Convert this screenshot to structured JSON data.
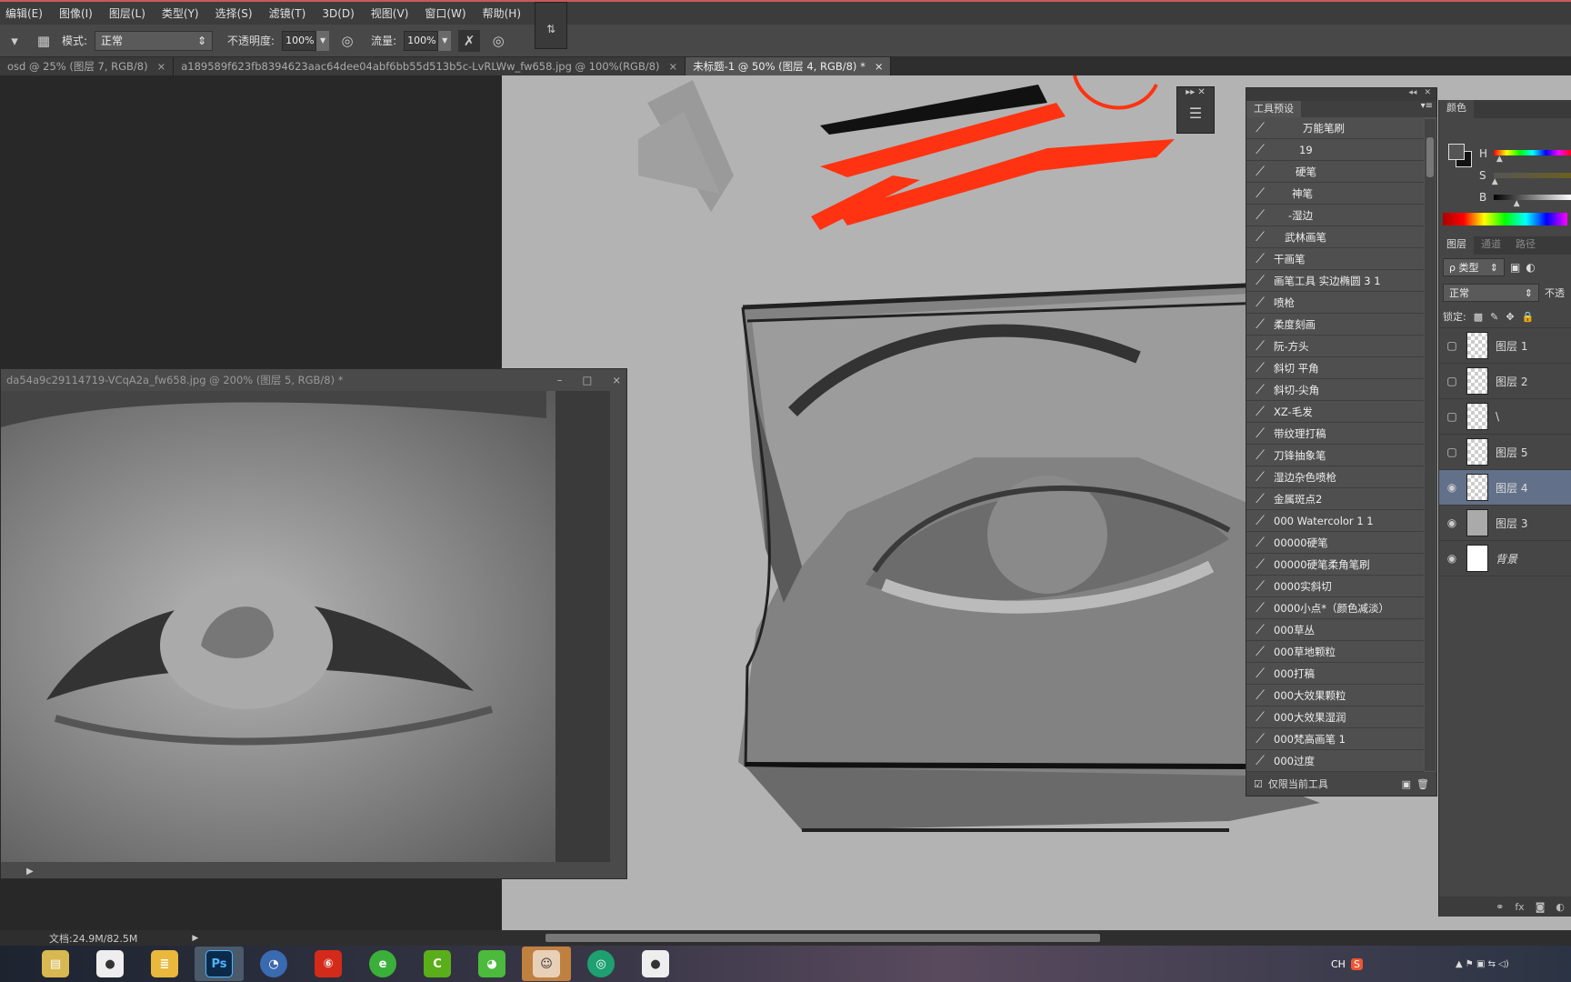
{
  "menu": [
    "编辑(E)",
    "图像(I)",
    "图层(L)",
    "类型(Y)",
    "选择(S)",
    "滤镜(T)",
    "3D(D)",
    "视图(V)",
    "窗口(W)",
    "帮助(H)"
  ],
  "options": {
    "mode_label": "模式:",
    "mode_value": "正常",
    "opacity_label": "不透明度:",
    "opacity_value": "100%",
    "flow_label": "流量:",
    "flow_value": "100%"
  },
  "tabs": [
    {
      "label": "osd @ 25% (图层 7, RGB/8)",
      "active": false
    },
    {
      "label": "a189589f623fb8394623aac64dee04abf6bb55d513b5c-LvRLWw_fw658.jpg @ 100%(RGB/8)",
      "active": false
    },
    {
      "label": "未标题-1 @ 50% (图层 4, RGB/8) *",
      "active": true
    }
  ],
  "tab_close": "×",
  "float_window": {
    "title": "da54a9c29114719-VCqA2a_fw658.jpg @ 200% (图层 5, RGB/8) *",
    "min": "–",
    "max": "□",
    "close": "×"
  },
  "presets": {
    "title": "工具预设",
    "items": [
      "万能笔刷",
      "19",
      "硬笔",
      "神笔",
      "-湿边",
      "武林画笔",
      "干画笔",
      "画笔工具 实边椭圆 3 1",
      "喷枪",
      "柔度刻画",
      "阮-方头",
      "斜切 平角",
      "斜切-尖角",
      "XZ-毛发",
      "带纹理打稿",
      "刀锋抽象笔",
      "湿边杂色喷枪",
      "金属斑点2",
      "000 Watercolor 1 1",
      "00000硬笔",
      "00000硬笔柔角笔刷",
      "0000实斜切",
      "0000小点*（颜色减淡）",
      "000草丛",
      "000草地颗粒",
      "000打稿",
      "000大效果颗粒",
      "000大效果湿润",
      "000梵高画笔 1",
      "000过度"
    ],
    "only_current": "仅限当前工具"
  },
  "color_panel": {
    "title": "颜色",
    "h": "H",
    "s": "S",
    "b": "B",
    "h_value": 0.08,
    "s_value": 0.02,
    "b_value": 0.3
  },
  "layers_panel": {
    "tabs": [
      "图层",
      "通道",
      "路径"
    ],
    "filter": "ρ 类型",
    "blend": "正常",
    "opacity_label": "不透",
    "lock_label": "锁定:",
    "layers": [
      {
        "name": "图层 1",
        "visible": false
      },
      {
        "name": "图层 2",
        "visible": false
      },
      {
        "name": "\\",
        "visible": false
      },
      {
        "name": "图层 5",
        "visible": false
      },
      {
        "name": "图层 4",
        "visible": true,
        "selected": true
      },
      {
        "name": "图层 3",
        "visible": true
      },
      {
        "name": "背景",
        "visible": true
      }
    ]
  },
  "status": {
    "doc": "文档:24.9M/82.5M"
  },
  "taskbar": {
    "ps": "Ps",
    "ime": "CH"
  },
  "colors": {
    "accent_red": "#ff3311",
    "selected_layer": "#627189"
  }
}
